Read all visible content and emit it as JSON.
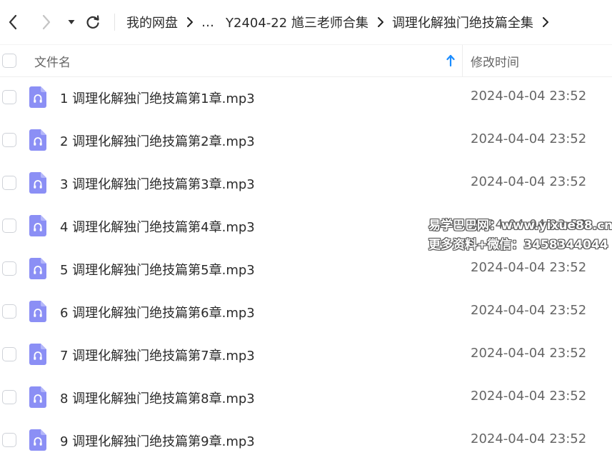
{
  "breadcrumb": [
    "我的网盘",
    "…",
    "Y2404-22 馗三老师合集",
    "调理化解独门绝技篇全集"
  ],
  "header": {
    "name_label": "文件名",
    "time_label": "修改时间"
  },
  "files": [
    {
      "name": "1 调理化解独门绝技篇第1章.mp3",
      "modified": "2024-04-04 23:52"
    },
    {
      "name": "2 调理化解独门绝技篇第2章.mp3",
      "modified": "2024-04-04 23:52"
    },
    {
      "name": "3 调理化解独门绝技篇第3章.mp3",
      "modified": "2024-04-04 23:52"
    },
    {
      "name": "4 调理化解独门绝技篇第4章.mp3",
      "modified": "2024-04-04 23:52"
    },
    {
      "name": "5 调理化解独门绝技篇第5章.mp3",
      "modified": "2024-04-04 23:52"
    },
    {
      "name": "6 调理化解独门绝技篇第6章.mp3",
      "modified": "2024-04-04 23:52"
    },
    {
      "name": "7 调理化解独门绝技篇第7章.mp3",
      "modified": "2024-04-04 23:52"
    },
    {
      "name": "8 调理化解独门绝技篇第8章.mp3",
      "modified": "2024-04-04 23:52"
    },
    {
      "name": "9 调理化解独门绝技篇第9章.mp3",
      "modified": "2024-04-04 23:52"
    }
  ],
  "watermark": [
    "易学巴巴网：www.yixue88.cn",
    "更多资料+微信：3458344044"
  ],
  "icons": {
    "back": "chevron-left-icon",
    "forward": "chevron-right-icon",
    "history": "caret-down-icon",
    "refresh": "refresh-icon",
    "sort": "sort-ascending-icon",
    "file": "audio-file-icon"
  },
  "colors": {
    "file_icon": "#8b8ff5",
    "sort_arrow": "#1a8cff",
    "forward_disabled": "#c4c4c4"
  }
}
